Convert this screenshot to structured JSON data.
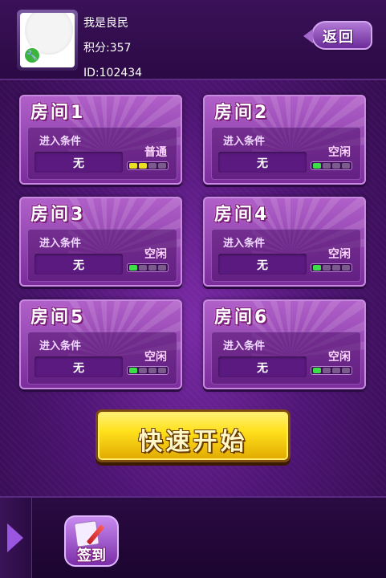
{
  "user": {
    "nickname": "我是良民",
    "score": "积分:357",
    "id": "ID:102434"
  },
  "header": {
    "back_label": "返回"
  },
  "rooms": [
    {
      "title": "房间1",
      "condition_label": "进入条件",
      "condition_value": "无",
      "status": "普通",
      "load_level": 2,
      "load_max": 4
    },
    {
      "title": "房间2",
      "condition_label": "进入条件",
      "condition_value": "无",
      "status": "空闲",
      "load_level": 1,
      "load_max": 4
    },
    {
      "title": "房间3",
      "condition_label": "进入条件",
      "condition_value": "无",
      "status": "空闲",
      "load_level": 1,
      "load_max": 4
    },
    {
      "title": "房间4",
      "condition_label": "进入条件",
      "condition_value": "无",
      "status": "空闲",
      "load_level": 1,
      "load_max": 4
    },
    {
      "title": "房间5",
      "condition_label": "进入条件",
      "condition_value": "无",
      "status": "空闲",
      "load_level": 1,
      "load_max": 4
    },
    {
      "title": "房间6",
      "condition_label": "进入条件",
      "condition_value": "无",
      "status": "空闲",
      "load_level": 1,
      "load_max": 4
    }
  ],
  "quick_start_label": "快速开始",
  "footer": {
    "checkin_label": "签到"
  },
  "colors": {
    "background": "#3a0d55",
    "busy_segment": "#e8e020",
    "free_segment": "#3ce046",
    "quick_start": "#ffe11c"
  },
  "icons": {
    "avatar_badge": "wrench-icon",
    "side_tab": "play-arrow-icon",
    "checkin": "checkin-pen-icon"
  }
}
